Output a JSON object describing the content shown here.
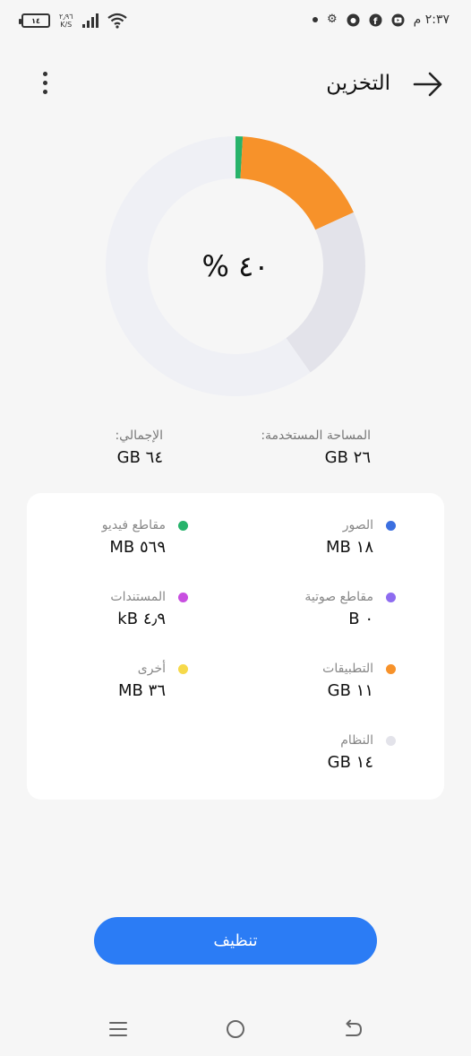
{
  "status_bar": {
    "time": "٢:٣٧ م",
    "battery_level": "١٤",
    "net_speed_value": "٢٫٩٦",
    "net_speed_unit": "K/S",
    "icons": [
      "dot-icon",
      "gear-icon",
      "app-icon",
      "facebook-icon",
      "youtube-icon"
    ],
    "left_icons": [
      "battery-icon",
      "signal-icon",
      "wifi-icon"
    ]
  },
  "header": {
    "title": "التخزين",
    "back_icon": "arrow-right-icon",
    "menu_icon": "more-vertical-icon"
  },
  "usage": {
    "percent_label": "٤٠ %",
    "used_label": "المساحة المستخدمة:",
    "used_value": "٢٦ GB",
    "total_label": "الإجمالي:",
    "total_value": "٦٤ GB"
  },
  "chart_data": {
    "type": "pie",
    "segments": [
      {
        "name": "الصور",
        "value": 0.018,
        "unit": "GB",
        "color": "#3b6fe0"
      },
      {
        "name": "مقاطع فيديو",
        "value": 0.569,
        "unit": "GB",
        "color": "#27b36b"
      },
      {
        "name": "مقاطع صوتية",
        "value": 0,
        "unit": "GB",
        "color": "#8e6cf0"
      },
      {
        "name": "المستندات",
        "value": 4.9e-06,
        "unit": "GB",
        "color": "#c84fe0"
      },
      {
        "name": "التطبيقات",
        "value": 11,
        "unit": "GB",
        "color": "#f7922a"
      },
      {
        "name": "أخرى",
        "value": 0.036,
        "unit": "GB",
        "color": "#f6d94a"
      },
      {
        "name": "النظام",
        "value": 14,
        "unit": "GB",
        "color": "#e3e3ea"
      },
      {
        "name": "free",
        "value": 38,
        "unit": "GB",
        "color": "#eff0f5"
      }
    ],
    "total": 64
  },
  "categories": [
    {
      "label": "الصور",
      "value": "١٨ MB",
      "color": "#3b6fe0"
    },
    {
      "label": "مقاطع فيديو",
      "value": "٥٦٩ MB",
      "color": "#27b36b"
    },
    {
      "label": "مقاطع صوتية",
      "value": "٠ B",
      "color": "#8e6cf0"
    },
    {
      "label": "المستندات",
      "value": "٤٫٩ kB",
      "color": "#c84fe0"
    },
    {
      "label": "التطبيقات",
      "value": "١١ GB",
      "color": "#f7922a"
    },
    {
      "label": "أخرى",
      "value": "٣٦ MB",
      "color": "#f6d94a"
    },
    {
      "label": "النظام",
      "value": "١٤ GB",
      "color": "#e3e3ea"
    }
  ],
  "clean_button": {
    "label": "تنظيف"
  },
  "nav_bar": {
    "icons": [
      "menu-icon",
      "home-icon",
      "back-icon"
    ]
  }
}
